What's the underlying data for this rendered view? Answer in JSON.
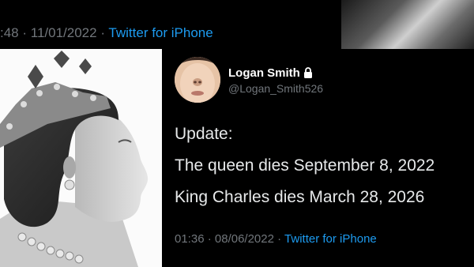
{
  "previous_tweet": {
    "time": ":48",
    "date": "11/01/2022",
    "separator": "·",
    "source": "Twitter for iPhone"
  },
  "tweet": {
    "display_name": "Logan Smith",
    "handle": "@Logan_Smith526",
    "protected_icon": "lock-icon",
    "lines": [
      "Update:",
      "The queen dies September 8, 2022",
      "King Charles dies March 28, 2026"
    ],
    "time": "01:36",
    "date": "08/06/2022",
    "separator": "·",
    "source": "Twitter for iPhone"
  },
  "colors": {
    "background": "#000000",
    "muted_text": "#71767b",
    "link": "#1d9bf0",
    "body_text": "#e7e9ea"
  }
}
